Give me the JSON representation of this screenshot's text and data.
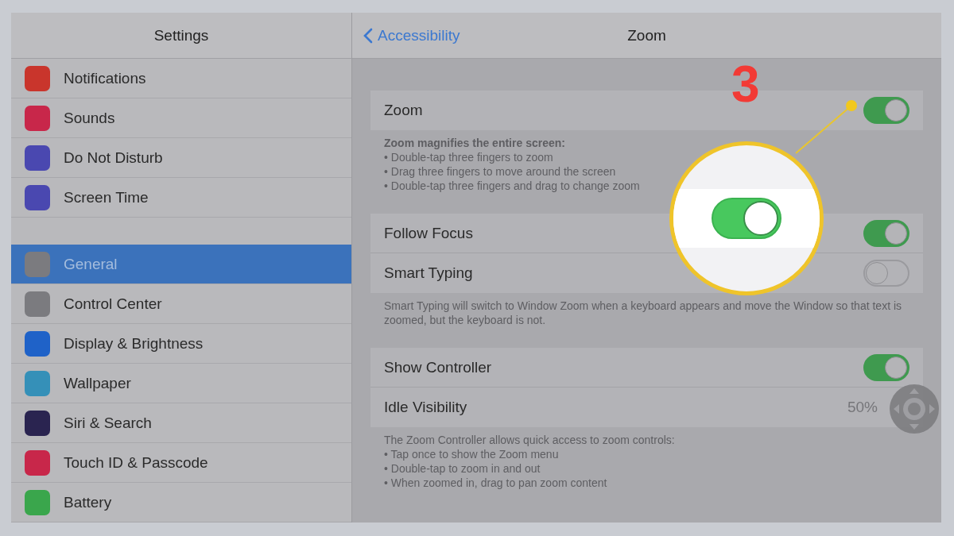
{
  "sidebar": {
    "title": "Settings",
    "groups": [
      {
        "items": [
          {
            "label": "Notifications",
            "color": "#c9352c",
            "selected": false
          },
          {
            "label": "Sounds",
            "color": "#c8274a",
            "selected": false
          },
          {
            "label": "Do Not Disturb",
            "color": "#4a48b0",
            "selected": false
          },
          {
            "label": "Screen Time",
            "color": "#4a48b0",
            "selected": false
          }
        ]
      },
      {
        "items": [
          {
            "label": "General",
            "color": "#7b7b7f",
            "selected": true
          },
          {
            "label": "Control Center",
            "color": "#7b7b7f",
            "selected": false
          },
          {
            "label": "Display & Brightness",
            "color": "#1f62c8",
            "selected": false
          },
          {
            "label": "Wallpaper",
            "color": "#3590b8",
            "selected": false
          },
          {
            "label": "Siri & Search",
            "color": "#2a2450",
            "selected": false
          },
          {
            "label": "Touch ID & Passcode",
            "color": "#c8274a",
            "selected": false
          },
          {
            "label": "Battery",
            "color": "#3aa64c",
            "selected": false
          }
        ]
      }
    ]
  },
  "detail": {
    "back": "Accessibility",
    "title": "Zoom",
    "groups": [
      {
        "rows": [
          {
            "kind": "toggle",
            "label": "Zoom",
            "on": true
          }
        ],
        "note": {
          "heading": "Zoom magnifies the entire screen:",
          "bullets": [
            "• Double-tap three fingers to zoom",
            "• Drag three fingers to move around the screen",
            "• Double-tap three fingers and drag to change zoom"
          ]
        }
      },
      {
        "rows": [
          {
            "kind": "toggle",
            "label": "Follow Focus",
            "on": true
          },
          {
            "kind": "toggle",
            "label": "Smart Typing",
            "on": false
          }
        ],
        "note": {
          "heading": "Smart Typing will switch to Window Zoom when a keyboard appears and move the Window so that text is zoomed, but the keyboard is not."
        }
      },
      {
        "rows": [
          {
            "kind": "toggle",
            "label": "Show Controller",
            "on": true
          },
          {
            "kind": "value",
            "label": "Idle Visibility",
            "value": "50%"
          }
        ],
        "note": {
          "heading": "The Zoom Controller allows quick access to zoom controls:",
          "bullets": [
            "• Tap once to show the Zoom menu",
            "• Double-tap to zoom in and out",
            "• When zoomed in, drag to pan zoom content"
          ]
        }
      }
    ]
  },
  "callout": {
    "number": "3",
    "on": true
  }
}
